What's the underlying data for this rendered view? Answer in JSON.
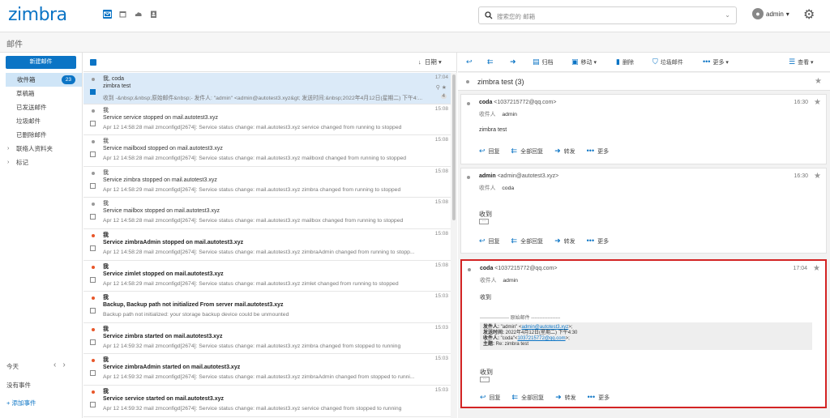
{
  "app": {
    "logo": "zimbra"
  },
  "search": {
    "placeholder": "搜索您的 邮箱"
  },
  "user": {
    "name": "admin"
  },
  "section_title": "邮件",
  "sidebar": {
    "new_mail": "新建邮件",
    "folders": [
      {
        "label": "收件箱",
        "count": "23"
      },
      {
        "label": "草稿箱"
      },
      {
        "label": "已发送邮件"
      },
      {
        "label": "垃圾邮件"
      },
      {
        "label": "已删除邮件"
      },
      {
        "label": "联络人资料夹"
      },
      {
        "label": "标记"
      }
    ],
    "calendar": {
      "today": "今天",
      "no_events": "没有事件",
      "add_event": "+ 添加事件"
    }
  },
  "list": {
    "sort": "日期",
    "rows": [
      {
        "from": "我, coda",
        "subject": "zimbra test",
        "preview": "收到 -&nbsp;&nbsp;原始邮件&nbsp;- 发件人: \"admin\" <admin@autotest3.xyz&gt; 发送时间:&nbsp;2022年4月12日(星期二) 下午4:...",
        "time": "17:04",
        "badge": "4",
        "selected": true,
        "unread": false
      },
      {
        "from": "我",
        "subject": "Service service stopped on mail.autotest3.xyz",
        "preview": "Apr 12 14:58:28 mail zmconfigd[2674]: Service status change: mail.autotest3.xyz service changed from running to stopped",
        "time": "15:08",
        "unread": false
      },
      {
        "from": "我",
        "subject": "Service mailboxd stopped on mail.autotest3.xyz",
        "preview": "Apr 12 14:58:28 mail zmconfigd[2674]: Service status change: mail.autotest3.xyz mailboxd changed from running to stopped",
        "time": "15:08",
        "unread": false
      },
      {
        "from": "我",
        "subject": "Service zimbra stopped on mail.autotest3.xyz",
        "preview": "Apr 12 14:58:29 mail zmconfigd[2674]: Service status change: mail.autotest3.xyz zimbra changed from running to stopped",
        "time": "15:08",
        "unread": false
      },
      {
        "from": "我",
        "subject": "Service mailbox stopped on mail.autotest3.xyz",
        "preview": "Apr 12 14:58:28 mail zmconfigd[2674]: Service status change: mail.autotest3.xyz mailbox changed from running to stopped",
        "time": "15:08",
        "unread": false
      },
      {
        "from": "我",
        "subject": "Service zimbraAdmin stopped on mail.autotest3.xyz",
        "preview": "Apr 12 14:58:28 mail zmconfigd[2674]: Service status change: mail.autotest3.xyz zimbraAdmin changed from running to stopp...",
        "time": "15:08",
        "unread": true
      },
      {
        "from": "我",
        "subject": "Service zimlet stopped on mail.autotest3.xyz",
        "preview": "Apr 12 14:58:29 mail zmconfigd[2674]: Service status change: mail.autotest3.xyz zimlet changed from running to stopped",
        "time": "15:08",
        "unread": true
      },
      {
        "from": "我",
        "subject": "Backup, Backup path not initialized From server mail.autotest3.xyz",
        "preview": "Backup path not initialized: your storage backup device could be unmounted",
        "time": "15:03",
        "unread": true
      },
      {
        "from": "我",
        "subject": "Service zimbra started on mail.autotest3.xyz",
        "preview": "Apr 12 14:59:32 mail zmconfigd[2674]: Service status change: mail.autotest3.xyz zimbra changed from stopped to running",
        "time": "15:03",
        "unread": true
      },
      {
        "from": "我",
        "subject": "Service zimbraAdmin started on mail.autotest3.xyz",
        "preview": "Apr 12 14:59:32 mail zmconfigd[2674]: Service status change: mail.autotest3.xyz zimbraAdmin changed from stopped to runni...",
        "time": "15:03",
        "unread": true
      },
      {
        "from": "我",
        "subject": "Service service started on mail.autotest3.xyz",
        "preview": "Apr 12 14:59:32 mail zmconfigd[2674]: Service status change: mail.autotest3.xyz service changed from stopped to running",
        "time": "15:03",
        "unread": true
      }
    ]
  },
  "toolbar": {
    "archive": "归档",
    "move": "移动",
    "delete": "删除",
    "spam": "垃圾邮件",
    "more": "更多",
    "view": "查看"
  },
  "conversation": {
    "title": "zimbra test (3)",
    "to_label": "收件人",
    "actions": {
      "reply": "回复",
      "reply_all": "全部回复",
      "forward": "转发",
      "more": "更多"
    },
    "messages": [
      {
        "from_name": "coda",
        "from_addr": "<1037215772@qq.com>",
        "to": "admin",
        "time": "16:30",
        "body": "zimbra test"
      },
      {
        "from_name": "admin",
        "from_addr": "<admin@autotest3.xyz>",
        "to": "coda",
        "time": "16:30",
        "body": "收到"
      },
      {
        "from_name": "coda",
        "from_addr": "<1037215772@qq.com>",
        "to": "admin",
        "time": "17:04",
        "body": "收到",
        "original_sep": "------------------ 原始邮件 ------------------",
        "orig": {
          "from_label": "发件人:",
          "from_val": "\"admin\" <",
          "from_link": "admin@autotest3.xyz",
          "from_end": ">;",
          "sent_label": "发送时间:",
          "sent_val": "2022年4月12日(星期二) 下午4:30",
          "to_label": "收件人:",
          "to_val": "\"coda\"<",
          "to_link": "1037215772@qq.com",
          "to_end": ">;",
          "subj_label": "主题:",
          "subj_val": "Re: zimbra test"
        },
        "body2": "收到"
      }
    ]
  }
}
